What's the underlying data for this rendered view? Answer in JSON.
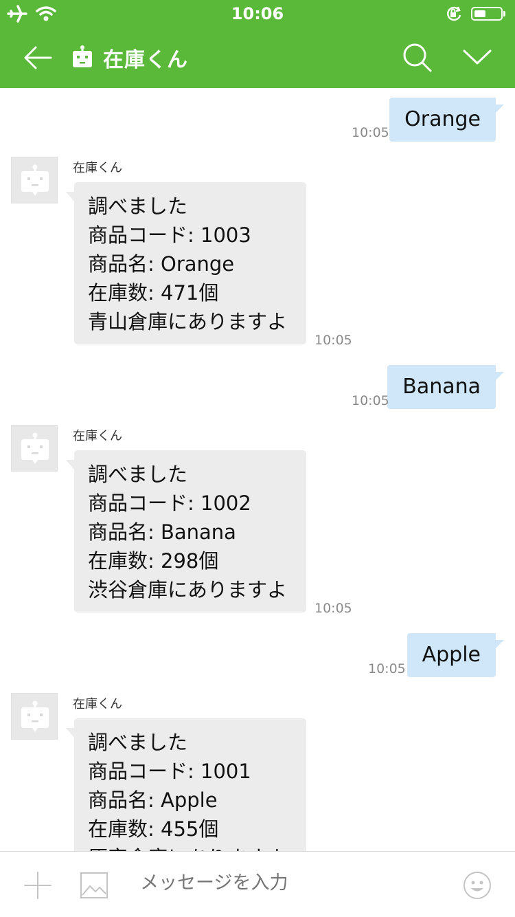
{
  "status": {
    "time": "10:06",
    "battery_level": 0.45
  },
  "header": {
    "title": "在庫くん"
  },
  "messages": [
    {
      "type": "out",
      "text": "Orange",
      "time": "10:05"
    },
    {
      "type": "in",
      "sender": "在庫くん",
      "lines": [
        "調べました",
        "商品コード: 1003",
        "商品名:  Orange",
        "在庫数:  471個",
        "青山倉庫にありますよ"
      ],
      "time": "10:05"
    },
    {
      "type": "out",
      "text": "Banana",
      "time": "10:05"
    },
    {
      "type": "in",
      "sender": "在庫くん",
      "lines": [
        "調べました",
        "商品コード: 1002",
        "商品名:  Banana",
        "在庫数:  298個",
        "渋谷倉庫にありますよ"
      ],
      "time": "10:05"
    },
    {
      "type": "out",
      "text": "Apple",
      "time": "10:05"
    },
    {
      "type": "in",
      "sender": "在庫くん",
      "lines": [
        "調べました",
        "商品コード: 1001",
        "商品名:  Apple",
        "在庫数:  455個",
        "原宿倉庫にありますよ"
      ],
      "time": ""
    }
  ],
  "input": {
    "placeholder": "メッセージを入力"
  },
  "colors": {
    "header": "#5ab939",
    "outgoing_bubble": "#cfe7f8",
    "incoming_bubble": "#ececec"
  },
  "icons": [
    "airplane-icon",
    "wifi-icon",
    "rotation-lock-icon",
    "battery-icon",
    "back-arrow-icon",
    "bot-icon",
    "search-icon",
    "chevron-down-icon",
    "plus-icon",
    "image-icon",
    "emoji-icon"
  ]
}
